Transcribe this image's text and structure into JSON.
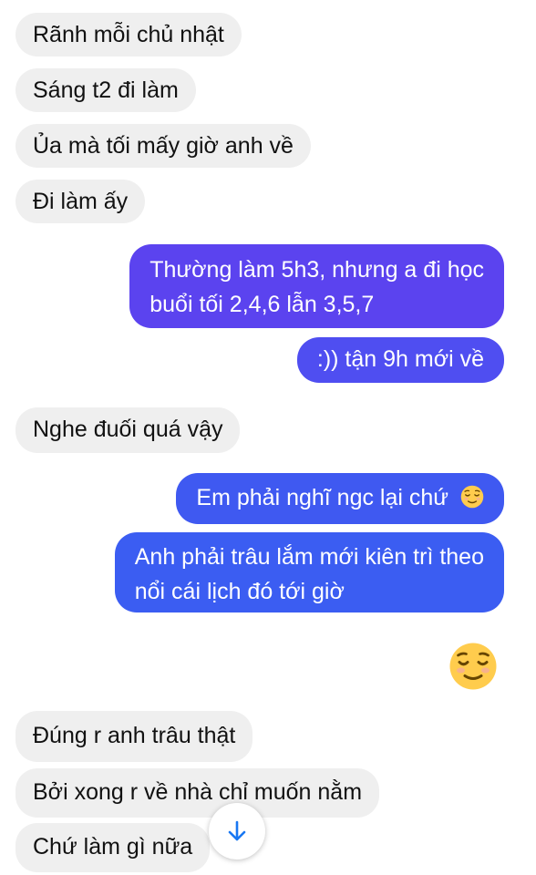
{
  "messages": {
    "m1": "Rãnh mỗi chủ nhật",
    "m2": "Sáng t2 đi làm",
    "m3": "Ủa mà tối mấy giờ anh về",
    "m4": "Đi làm ấy",
    "m5_line1": "Thường làm 5h3, nhưng a đi học",
    "m5_line2": "buổi tối 2,4,6 lẫn 3,5,7",
    "m6": ":)) tận 9h mới về",
    "m7": "Nghe đuối quá vậy",
    "m8": "Em phải nghĩ ngc lại chứ",
    "m9_line1": "Anh phải trâu lắm mới kiên trì theo",
    "m9_line2": "nổi cái lịch đó tới giờ",
    "m11": "Đúng r anh trâu thật",
    "m12": "Bởi xong r về nhà chỉ muốn nằm",
    "m13": "Chứ làm gì nữa"
  },
  "icons": {
    "relieved_emoji": "relieved-face-emoji",
    "scroll_down": "arrow-down-icon"
  },
  "colors": {
    "incoming_bubble": "#efefef",
    "outgoing_gradient_top": "#5b43ef",
    "outgoing_gradient_bottom": "#3160f3",
    "scroll_arrow": "#1877f2"
  }
}
